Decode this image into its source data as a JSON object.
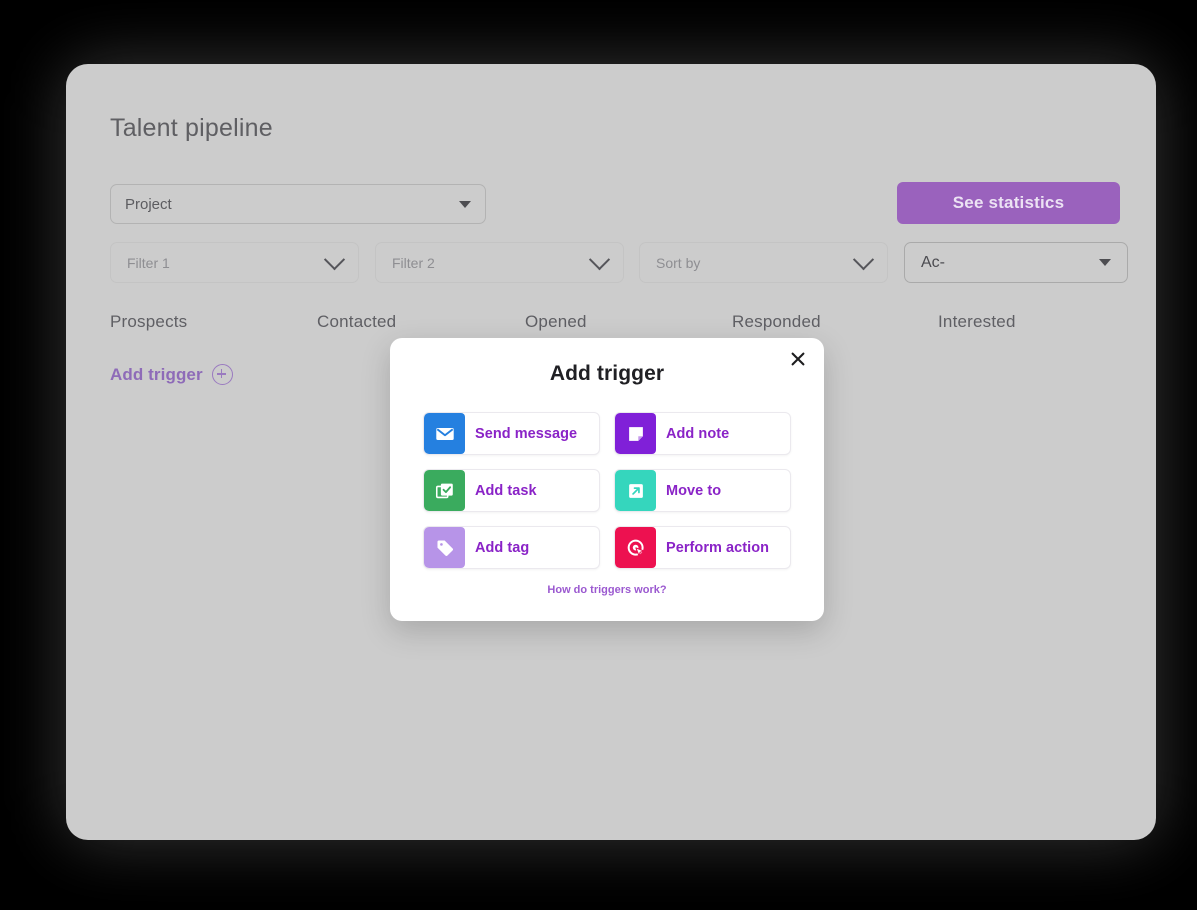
{
  "page": {
    "title": "Talent pipeline",
    "project_select": {
      "value": "Project",
      "caret_icon": "caret-down-icon"
    },
    "see_statistics_label": "See statistics",
    "filters": [
      {
        "name": "filter-1",
        "placeholder": "Filter 1",
        "icon": "chevron-down-icon"
      },
      {
        "name": "filter-2",
        "placeholder": "Filter 2",
        "icon": "chevron-down-icon"
      },
      {
        "name": "sort-by",
        "placeholder": "Sort by",
        "icon": "chevron-down-icon"
      }
    ],
    "action_select": {
      "value": "Ac-",
      "caret_icon": "caret-down-icon"
    },
    "columns": [
      "Prospects",
      "Contacted",
      "Opened",
      "Responded",
      "Interested"
    ],
    "add_trigger_link": {
      "label": "Add trigger",
      "icon": "plus-circle-icon"
    }
  },
  "modal": {
    "title": "Add trigger",
    "close_icon": "close-icon",
    "how_link": "How do triggers work?",
    "triggers": [
      {
        "label": "Send message",
        "icon": "envelope-icon",
        "color": "#2580e0"
      },
      {
        "label": "Add note",
        "icon": "note-icon",
        "color": "#8020d8"
      },
      {
        "label": "Add task",
        "icon": "task-check-icon",
        "color": "#3aab5e"
      },
      {
        "label": "Move to",
        "icon": "arrow-out-box-icon",
        "color": "#35d6bd"
      },
      {
        "label": "Add tag",
        "icon": "tag-icon",
        "color": "#b794e8"
      },
      {
        "label": "Perform action",
        "icon": "target-cursor-icon",
        "color": "#ed1150"
      }
    ]
  },
  "colors": {
    "background": "#000000",
    "card": "#cccccc",
    "accent_purple": "#9a62bd",
    "link_purple": "#8a23c7"
  }
}
